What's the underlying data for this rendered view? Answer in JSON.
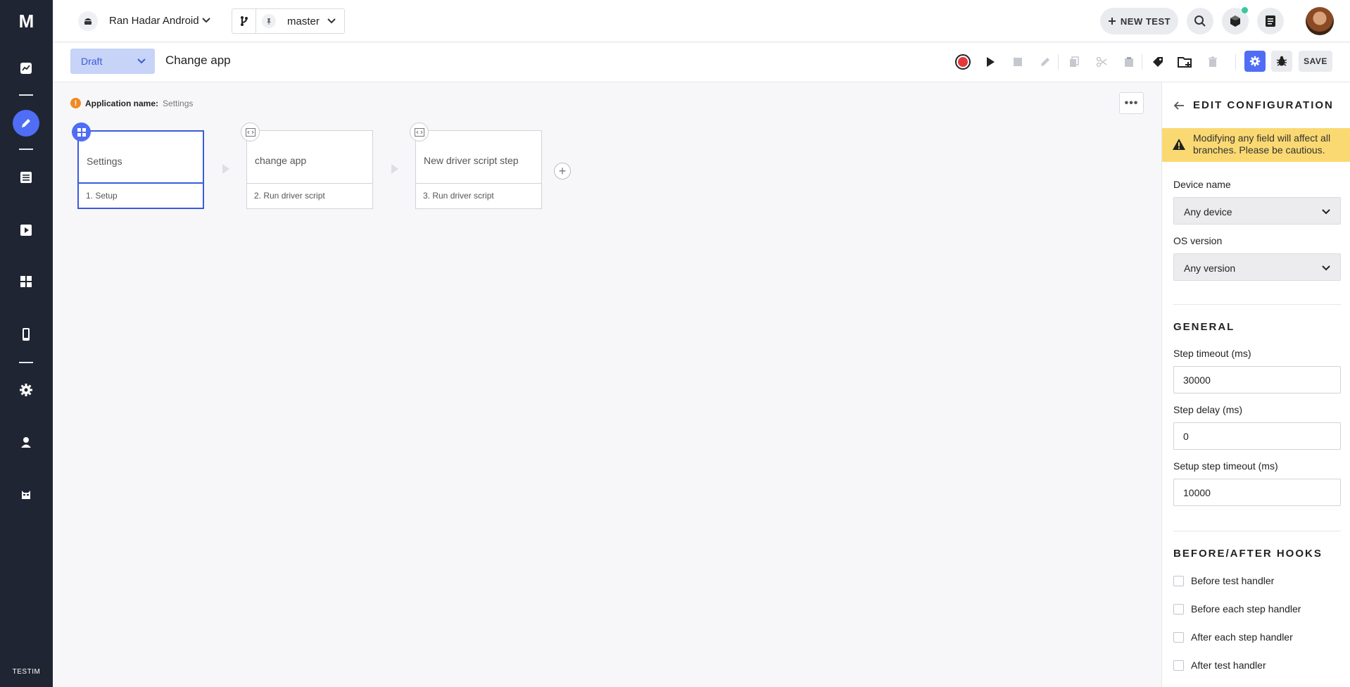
{
  "nav": {
    "logo": "M",
    "brand": "TESTIM"
  },
  "header": {
    "project_name": "Ran Hadar Android",
    "branch_name": "master",
    "new_test_label": "NEW TEST"
  },
  "toolbar": {
    "status": "Draft",
    "test_title": "Change app",
    "save_label": "SAVE"
  },
  "canvas": {
    "app_name_label": "Application name:",
    "app_name_value": "Settings",
    "more_label": "•••",
    "add_label": "+",
    "steps": [
      {
        "name": "Settings",
        "footer": "1. Setup"
      },
      {
        "name": "change app",
        "footer": "2. Run driver script"
      },
      {
        "name": "New driver script step",
        "footer": "3. Run driver script"
      }
    ]
  },
  "panel": {
    "title": "EDIT CONFIGURATION",
    "warning": "Modifying any field will affect all branches. Please be cautious.",
    "device_label": "Device name",
    "device_value": "Any device",
    "os_label": "OS version",
    "os_value": "Any version",
    "general_title": "GENERAL",
    "step_timeout_label": "Step timeout (ms)",
    "step_timeout_value": "30000",
    "step_delay_label": "Step delay (ms)",
    "step_delay_value": "0",
    "setup_timeout_label": "Setup step timeout (ms)",
    "setup_timeout_value": "10000",
    "hooks_title": "BEFORE/AFTER HOOKS",
    "hooks": [
      "Before test handler",
      "Before each step handler",
      "After each step handler",
      "After test handler"
    ]
  },
  "colors": {
    "nav_bg": "#1f2533",
    "accent": "#4f6df5",
    "warning_bg": "#fbd972",
    "record_red": "#e5383b"
  },
  "icons": [
    "dashboard-icon",
    "pen-icon",
    "list-icon",
    "play-icon",
    "grid-icon",
    "mobile-icon",
    "gear-icon",
    "user-icon",
    "bot-icon",
    "android-icon",
    "branch-icon",
    "pin-icon",
    "search-icon",
    "cube-icon",
    "notes-icon",
    "record-icon",
    "stop-icon",
    "copy-icon",
    "cut-icon",
    "paste-icon",
    "tag-icon",
    "folder-add-icon",
    "trash-icon",
    "bug-icon",
    "back-arrow-icon",
    "warning-icon"
  ]
}
